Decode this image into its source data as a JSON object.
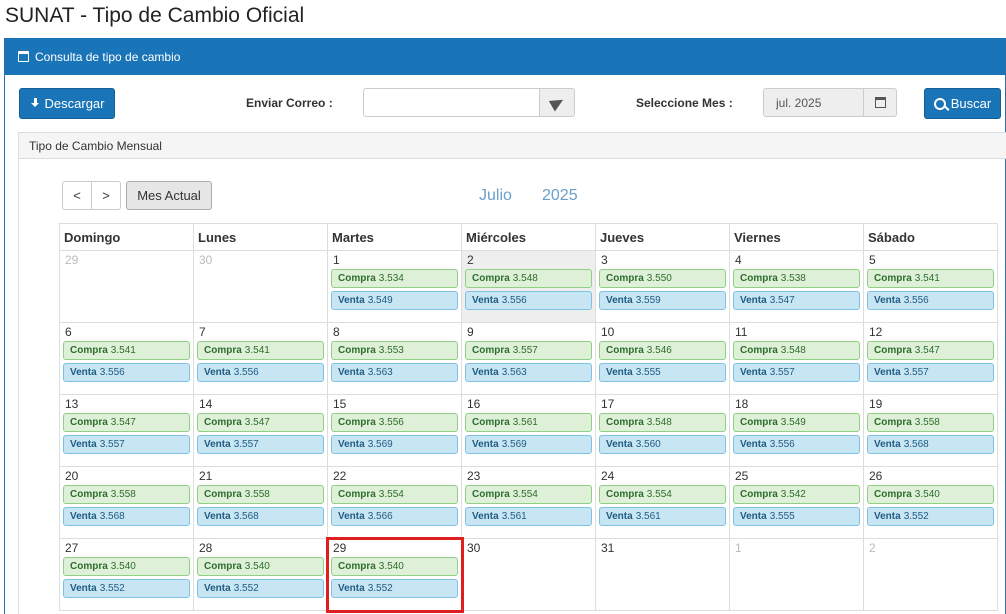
{
  "page": {
    "title": "SUNAT - Tipo de Cambio Oficial"
  },
  "panel": {
    "title": "Consulta de tipo de cambio"
  },
  "toolbar": {
    "download_label": "Descargar",
    "email_label": "Enviar Correo :",
    "email_value": "",
    "month_label": "Seleccione Mes :",
    "month_value": "jul. 2025",
    "search_label": "Buscar"
  },
  "monthly": {
    "title": "Tipo de Cambio Mensual"
  },
  "calendar": {
    "prev_label": "<",
    "next_label": ">",
    "current_label": "Mes Actual",
    "month_name": "Julio",
    "year": "2025",
    "weekdays": [
      "Domingo",
      "Lunes",
      "Martes",
      "Miércoles",
      "Jueves",
      "Viernes",
      "Sábado"
    ],
    "compra_label": "Compra",
    "venta_label": "Venta",
    "weeks": [
      [
        {
          "day": "29",
          "other": true
        },
        {
          "day": "30",
          "other": true
        },
        {
          "day": "1",
          "compra": "3.534",
          "venta": "3.549"
        },
        {
          "day": "2",
          "compra": "3.548",
          "venta": "3.556",
          "today": true
        },
        {
          "day": "3",
          "compra": "3.550",
          "venta": "3.559"
        },
        {
          "day": "4",
          "compra": "3.538",
          "venta": "3.547"
        },
        {
          "day": "5",
          "compra": "3.541",
          "venta": "3.556"
        }
      ],
      [
        {
          "day": "6",
          "compra": "3.541",
          "venta": "3.556"
        },
        {
          "day": "7",
          "compra": "3.541",
          "venta": "3.556"
        },
        {
          "day": "8",
          "compra": "3.553",
          "venta": "3.563"
        },
        {
          "day": "9",
          "compra": "3.557",
          "venta": "3.563"
        },
        {
          "day": "10",
          "compra": "3.546",
          "venta": "3.555"
        },
        {
          "day": "11",
          "compra": "3.548",
          "venta": "3.557"
        },
        {
          "day": "12",
          "compra": "3.547",
          "venta": "3.557"
        }
      ],
      [
        {
          "day": "13",
          "compra": "3.547",
          "venta": "3.557"
        },
        {
          "day": "14",
          "compra": "3.547",
          "venta": "3.557"
        },
        {
          "day": "15",
          "compra": "3.556",
          "venta": "3.569"
        },
        {
          "day": "16",
          "compra": "3.561",
          "venta": "3.569"
        },
        {
          "day": "17",
          "compra": "3.548",
          "venta": "3.560"
        },
        {
          "day": "18",
          "compra": "3.549",
          "venta": "3.556"
        },
        {
          "day": "19",
          "compra": "3.558",
          "venta": "3.568"
        }
      ],
      [
        {
          "day": "20",
          "compra": "3.558",
          "venta": "3.568"
        },
        {
          "day": "21",
          "compra": "3.558",
          "venta": "3.568"
        },
        {
          "day": "22",
          "compra": "3.554",
          "venta": "3.566"
        },
        {
          "day": "23",
          "compra": "3.554",
          "venta": "3.561"
        },
        {
          "day": "24",
          "compra": "3.554",
          "venta": "3.561"
        },
        {
          "day": "25",
          "compra": "3.542",
          "venta": "3.555"
        },
        {
          "day": "26",
          "compra": "3.540",
          "venta": "3.552"
        }
      ],
      [
        {
          "day": "27",
          "compra": "3.540",
          "venta": "3.552"
        },
        {
          "day": "28",
          "compra": "3.540",
          "venta": "3.552"
        },
        {
          "day": "29",
          "compra": "3.540",
          "venta": "3.552",
          "highlight": true
        },
        {
          "day": "30"
        },
        {
          "day": "31"
        },
        {
          "day": "1",
          "other": true
        },
        {
          "day": "2",
          "other": true
        }
      ]
    ]
  },
  "colors": {
    "primary": "#1a75b8",
    "compra_bg": "#dff0d8",
    "venta_bg": "#c8e5f3",
    "highlight": "#e01e1e"
  }
}
